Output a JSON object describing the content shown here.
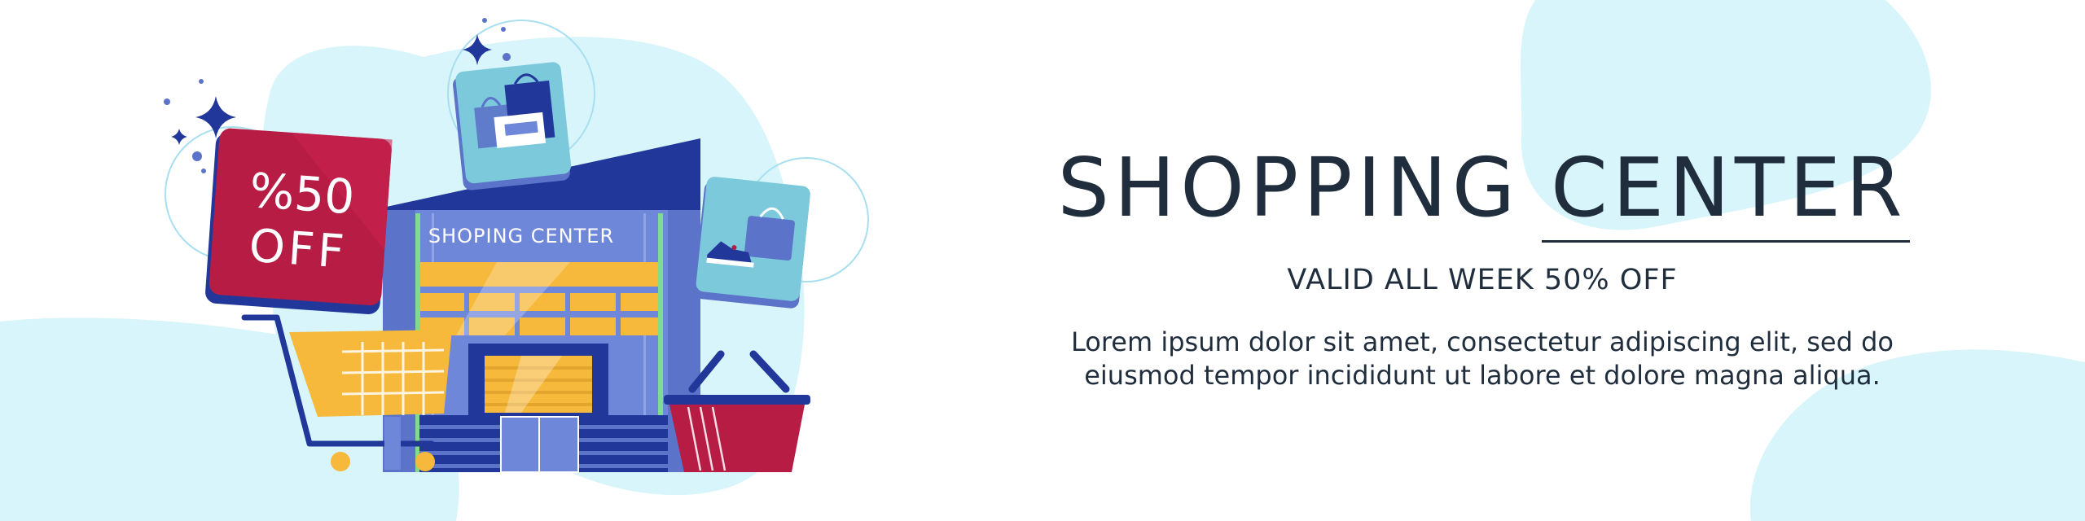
{
  "banner": {
    "title": "SHOPPING CENTER",
    "subtitle": "VALID ALL WEEK 50% OFF",
    "body_line_1": "Lorem ipsum dolor sit amet, consectetur adipiscing elit, sed do",
    "body_line_2": "eiusmod tempor incididunt ut labore et dolore magna aliqua."
  },
  "illustration": {
    "discount_line_1": "%50",
    "discount_line_2": "OFF",
    "store_sign": "SHOPING CENTER"
  },
  "colors": {
    "text": "#1f2d3d",
    "blob": "#d7f5fb",
    "navy": "#22379a",
    "crimson": "#b71c45",
    "yellow": "#f6b93b",
    "periwinkle": "#6f87d8"
  }
}
